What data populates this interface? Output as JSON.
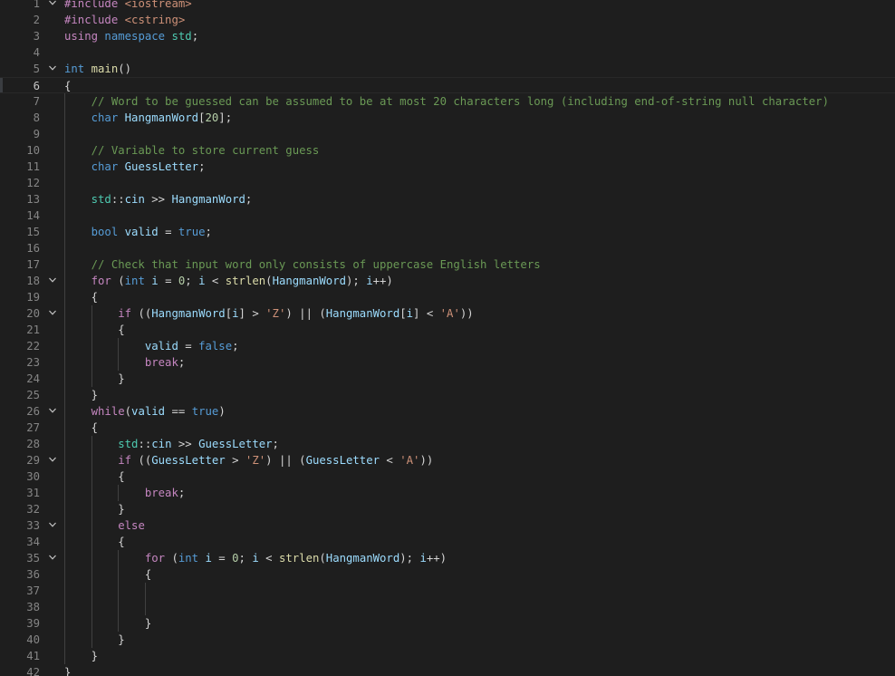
{
  "editor": {
    "language": "cpp",
    "colors": {
      "background": "#1e1e1e",
      "line_number": "#858585",
      "keyword": "#569cd6",
      "control": "#c586c0",
      "function": "#dcdcaa",
      "variable": "#9cdcfe",
      "namespace": "#4ec9b0",
      "number": "#b5cea8",
      "string": "#ce9178",
      "comment": "#6a9955"
    },
    "fold_icon": "chevron-down-icon",
    "lines": [
      {
        "n": "1",
        "fold": true,
        "indent": 0,
        "tokens": [
          {
            "t": "#include ",
            "c": "ctl"
          },
          {
            "t": "<iostream>",
            "c": "str"
          }
        ]
      },
      {
        "n": "2",
        "indent": 0,
        "tokens": [
          {
            "t": "#include ",
            "c": "ctl"
          },
          {
            "t": "<cstring>",
            "c": "str"
          }
        ]
      },
      {
        "n": "3",
        "indent": 0,
        "tokens": [
          {
            "t": "using ",
            "c": "ctl"
          },
          {
            "t": "namespace ",
            "c": "kw"
          },
          {
            "t": "std",
            "c": "ns"
          },
          {
            "t": ";",
            "c": "op"
          }
        ]
      },
      {
        "n": "4",
        "indent": 0,
        "tokens": []
      },
      {
        "n": "5",
        "fold": true,
        "indent": 0,
        "tokens": [
          {
            "t": "int ",
            "c": "kw"
          },
          {
            "t": "main",
            "c": "fn"
          },
          {
            "t": "()",
            "c": "op"
          }
        ]
      },
      {
        "n": "6",
        "indent": 0,
        "current": true,
        "tokens": [
          {
            "t": "{",
            "c": "op"
          }
        ]
      },
      {
        "n": "7",
        "indent": 1,
        "tokens": [
          {
            "t": "// Word to be guessed can be assumed to be at most 20 characters long (including end-of-string null character)",
            "c": "com"
          }
        ]
      },
      {
        "n": "8",
        "indent": 1,
        "tokens": [
          {
            "t": "char ",
            "c": "kw"
          },
          {
            "t": "HangmanWord",
            "c": "var"
          },
          {
            "t": "[",
            "c": "op"
          },
          {
            "t": "20",
            "c": "num"
          },
          {
            "t": "];",
            "c": "op"
          }
        ]
      },
      {
        "n": "9",
        "indent": 1,
        "tokens": []
      },
      {
        "n": "10",
        "indent": 1,
        "tokens": [
          {
            "t": "// Variable to store current guess",
            "c": "com"
          }
        ]
      },
      {
        "n": "11",
        "indent": 1,
        "tokens": [
          {
            "t": "char ",
            "c": "kw"
          },
          {
            "t": "GuessLetter",
            "c": "var"
          },
          {
            "t": ";",
            "c": "op"
          }
        ]
      },
      {
        "n": "12",
        "indent": 1,
        "tokens": []
      },
      {
        "n": "13",
        "indent": 1,
        "tokens": [
          {
            "t": "std",
            "c": "ns"
          },
          {
            "t": "::",
            "c": "op"
          },
          {
            "t": "cin",
            "c": "var"
          },
          {
            "t": " >> ",
            "c": "op"
          },
          {
            "t": "HangmanWord",
            "c": "var"
          },
          {
            "t": ";",
            "c": "op"
          }
        ]
      },
      {
        "n": "14",
        "indent": 1,
        "tokens": []
      },
      {
        "n": "15",
        "indent": 1,
        "tokens": [
          {
            "t": "bool ",
            "c": "kw"
          },
          {
            "t": "valid",
            "c": "var"
          },
          {
            "t": " = ",
            "c": "op"
          },
          {
            "t": "true",
            "c": "kw"
          },
          {
            "t": ";",
            "c": "op"
          }
        ]
      },
      {
        "n": "16",
        "indent": 1,
        "tokens": []
      },
      {
        "n": "17",
        "indent": 1,
        "tokens": [
          {
            "t": "// Check that input word only consists of uppercase English letters",
            "c": "com"
          }
        ]
      },
      {
        "n": "18",
        "fold": true,
        "indent": 1,
        "tokens": [
          {
            "t": "for",
            "c": "ctl"
          },
          {
            "t": " (",
            "c": "op"
          },
          {
            "t": "int ",
            "c": "kw"
          },
          {
            "t": "i",
            "c": "var"
          },
          {
            "t": " = ",
            "c": "op"
          },
          {
            "t": "0",
            "c": "num"
          },
          {
            "t": "; ",
            "c": "op"
          },
          {
            "t": "i",
            "c": "var"
          },
          {
            "t": " < ",
            "c": "op"
          },
          {
            "t": "strlen",
            "c": "fn"
          },
          {
            "t": "(",
            "c": "op"
          },
          {
            "t": "HangmanWord",
            "c": "var"
          },
          {
            "t": "); ",
            "c": "op"
          },
          {
            "t": "i",
            "c": "var"
          },
          {
            "t": "++)",
            "c": "op"
          }
        ]
      },
      {
        "n": "19",
        "indent": 1,
        "tokens": [
          {
            "t": "{",
            "c": "op"
          }
        ]
      },
      {
        "n": "20",
        "fold": true,
        "indent": 2,
        "tokens": [
          {
            "t": "if",
            "c": "ctl"
          },
          {
            "t": " ((",
            "c": "op"
          },
          {
            "t": "HangmanWord",
            "c": "var"
          },
          {
            "t": "[",
            "c": "op"
          },
          {
            "t": "i",
            "c": "var"
          },
          {
            "t": "] > ",
            "c": "op"
          },
          {
            "t": "'Z'",
            "c": "str"
          },
          {
            "t": ") || (",
            "c": "op"
          },
          {
            "t": "HangmanWord",
            "c": "var"
          },
          {
            "t": "[",
            "c": "op"
          },
          {
            "t": "i",
            "c": "var"
          },
          {
            "t": "] < ",
            "c": "op"
          },
          {
            "t": "'A'",
            "c": "str"
          },
          {
            "t": "))",
            "c": "op"
          }
        ]
      },
      {
        "n": "21",
        "indent": 2,
        "tokens": [
          {
            "t": "{",
            "c": "op"
          }
        ]
      },
      {
        "n": "22",
        "indent": 3,
        "tokens": [
          {
            "t": "valid",
            "c": "var"
          },
          {
            "t": " = ",
            "c": "op"
          },
          {
            "t": "false",
            "c": "kw"
          },
          {
            "t": ";",
            "c": "op"
          }
        ]
      },
      {
        "n": "23",
        "indent": 3,
        "tokens": [
          {
            "t": "break",
            "c": "ctl"
          },
          {
            "t": ";",
            "c": "op"
          }
        ]
      },
      {
        "n": "24",
        "indent": 2,
        "tokens": [
          {
            "t": "}",
            "c": "op"
          }
        ]
      },
      {
        "n": "25",
        "indent": 1,
        "tokens": [
          {
            "t": "}",
            "c": "op"
          }
        ]
      },
      {
        "n": "26",
        "fold": true,
        "indent": 1,
        "tokens": [
          {
            "t": "while",
            "c": "ctl"
          },
          {
            "t": "(",
            "c": "op"
          },
          {
            "t": "valid",
            "c": "var"
          },
          {
            "t": " == ",
            "c": "op"
          },
          {
            "t": "true",
            "c": "kw"
          },
          {
            "t": ")",
            "c": "op"
          }
        ]
      },
      {
        "n": "27",
        "indent": 1,
        "tokens": [
          {
            "t": "{",
            "c": "op"
          }
        ]
      },
      {
        "n": "28",
        "indent": 2,
        "tokens": [
          {
            "t": "std",
            "c": "ns"
          },
          {
            "t": "::",
            "c": "op"
          },
          {
            "t": "cin",
            "c": "var"
          },
          {
            "t": " >> ",
            "c": "op"
          },
          {
            "t": "GuessLetter",
            "c": "var"
          },
          {
            "t": ";",
            "c": "op"
          }
        ]
      },
      {
        "n": "29",
        "fold": true,
        "indent": 2,
        "tokens": [
          {
            "t": "if",
            "c": "ctl"
          },
          {
            "t": " ((",
            "c": "op"
          },
          {
            "t": "GuessLetter",
            "c": "var"
          },
          {
            "t": " > ",
            "c": "op"
          },
          {
            "t": "'Z'",
            "c": "str"
          },
          {
            "t": ") || (",
            "c": "op"
          },
          {
            "t": "GuessLetter",
            "c": "var"
          },
          {
            "t": " < ",
            "c": "op"
          },
          {
            "t": "'A'",
            "c": "str"
          },
          {
            "t": "))",
            "c": "op"
          }
        ]
      },
      {
        "n": "30",
        "indent": 2,
        "tokens": [
          {
            "t": "{",
            "c": "op"
          }
        ]
      },
      {
        "n": "31",
        "indent": 3,
        "tokens": [
          {
            "t": "break",
            "c": "ctl"
          },
          {
            "t": ";",
            "c": "op"
          }
        ]
      },
      {
        "n": "32",
        "indent": 2,
        "tokens": [
          {
            "t": "}",
            "c": "op"
          }
        ]
      },
      {
        "n": "33",
        "fold": true,
        "indent": 2,
        "tokens": [
          {
            "t": "else",
            "c": "ctl"
          }
        ]
      },
      {
        "n": "34",
        "indent": 2,
        "tokens": [
          {
            "t": "{",
            "c": "op"
          }
        ]
      },
      {
        "n": "35",
        "fold": true,
        "indent": 3,
        "tokens": [
          {
            "t": "for",
            "c": "ctl"
          },
          {
            "t": " (",
            "c": "op"
          },
          {
            "t": "int ",
            "c": "kw"
          },
          {
            "t": "i",
            "c": "var"
          },
          {
            "t": " = ",
            "c": "op"
          },
          {
            "t": "0",
            "c": "num"
          },
          {
            "t": "; ",
            "c": "op"
          },
          {
            "t": "i",
            "c": "var"
          },
          {
            "t": " < ",
            "c": "op"
          },
          {
            "t": "strlen",
            "c": "fn"
          },
          {
            "t": "(",
            "c": "op"
          },
          {
            "t": "HangmanWord",
            "c": "var"
          },
          {
            "t": "); ",
            "c": "op"
          },
          {
            "t": "i",
            "c": "var"
          },
          {
            "t": "++)",
            "c": "op"
          }
        ]
      },
      {
        "n": "36",
        "indent": 3,
        "tokens": [
          {
            "t": "{",
            "c": "op"
          }
        ]
      },
      {
        "n": "37",
        "indent": 4,
        "tokens": []
      },
      {
        "n": "38",
        "indent": 4,
        "tokens": []
      },
      {
        "n": "39",
        "indent": 3,
        "tokens": [
          {
            "t": "}",
            "c": "op"
          }
        ]
      },
      {
        "n": "40",
        "indent": 2,
        "tokens": [
          {
            "t": "}",
            "c": "op"
          }
        ]
      },
      {
        "n": "41",
        "indent": 1,
        "tokens": [
          {
            "t": "}",
            "c": "op"
          }
        ]
      },
      {
        "n": "42",
        "indent": 0,
        "tokens": [
          {
            "t": "}",
            "c": "op"
          }
        ]
      }
    ]
  }
}
